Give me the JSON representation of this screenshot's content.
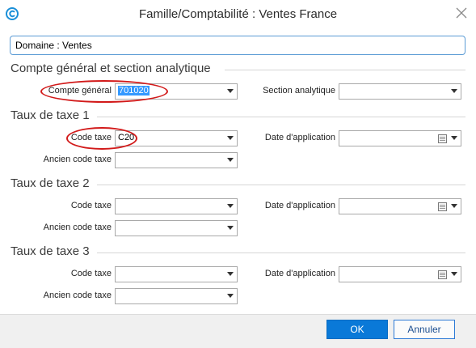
{
  "window": {
    "title": "Famille/Comptabilité : Ventes France"
  },
  "domain": {
    "value": "Domaine : Ventes"
  },
  "sections": {
    "compte": {
      "title": "Compte général et section analytique"
    },
    "taxe1": {
      "title": "Taux de taxe 1"
    },
    "taxe2": {
      "title": "Taux de taxe 2"
    },
    "taxe3": {
      "title": "Taux de taxe 3"
    }
  },
  "fields": {
    "compte_general": {
      "label": "Compte général",
      "value": "701020"
    },
    "section_analytique": {
      "label": "Section analytique",
      "value": ""
    },
    "taxe1_code": {
      "label": "Code taxe",
      "value": "C20"
    },
    "taxe1_date": {
      "label": "Date d'application",
      "value": ""
    },
    "taxe1_ancien": {
      "label": "Ancien code taxe",
      "value": ""
    },
    "taxe2_code": {
      "label": "Code taxe",
      "value": ""
    },
    "taxe2_date": {
      "label": "Date d'application",
      "value": ""
    },
    "taxe2_ancien": {
      "label": "Ancien code taxe",
      "value": ""
    },
    "taxe3_code": {
      "label": "Code taxe",
      "value": ""
    },
    "taxe3_date": {
      "label": "Date d'application",
      "value": ""
    },
    "taxe3_ancien": {
      "label": "Ancien code taxe",
      "value": ""
    }
  },
  "buttons": {
    "ok": "OK",
    "cancel": "Annuler"
  },
  "icons": {
    "app": "sage-logo-icon",
    "close": "close-icon",
    "dropdown": "chevron-down-icon",
    "calendar": "calendar-icon"
  },
  "colors": {
    "accent": "#0a79d8",
    "focus_border": "#5b9bd5",
    "annotation": "#d21a1a",
    "selection": "#3399ff"
  }
}
